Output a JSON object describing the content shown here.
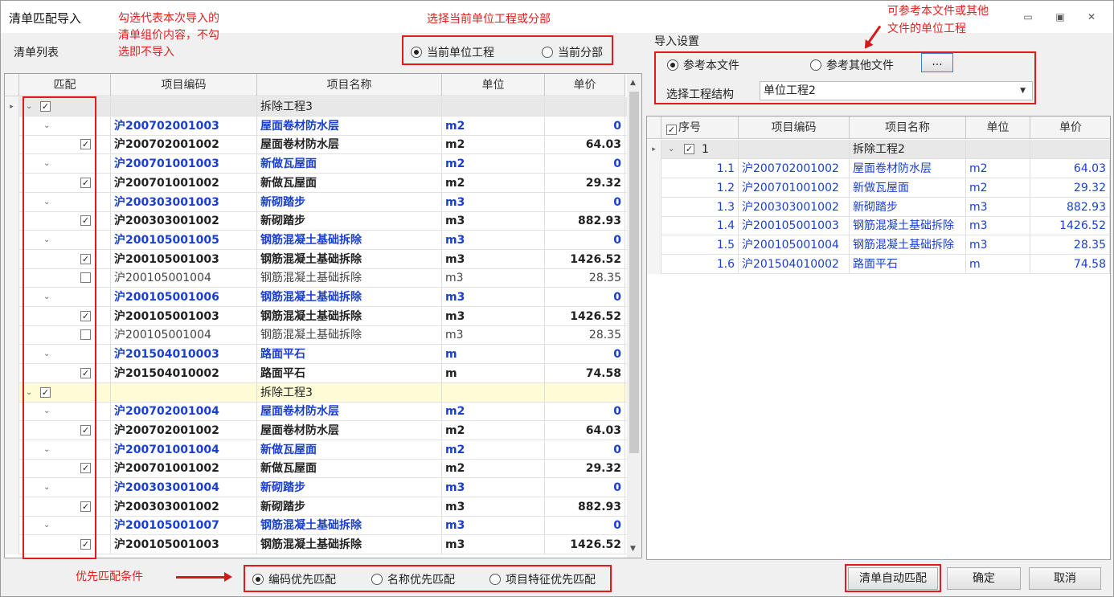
{
  "window": {
    "title": "清单匹配导入"
  },
  "notes": {
    "checkbox_hint": "勾选代表本次导入的\n清单组价内容，不勾\n选即不导入",
    "scope_hint": "选择当前单位工程或分部",
    "ref_hint": "可参考本文件或其他\n文件的单位工程",
    "priority_hint": "优先匹配条件"
  },
  "left": {
    "list_label": "清单列表",
    "scope_options": [
      {
        "label": "当前单位工程",
        "selected": true
      },
      {
        "label": "当前分部",
        "selected": false
      }
    ],
    "columns": [
      "匹配",
      "项目编码",
      "项目名称",
      "单位",
      "单价"
    ],
    "rows": [
      {
        "kind": "group",
        "checked": true,
        "code": "",
        "name": "拆除工程3",
        "unit": "",
        "price": ""
      },
      {
        "kind": "target",
        "code": "沪200702001003",
        "name": "屋面卷材防水层",
        "unit": "m2",
        "price": "0"
      },
      {
        "kind": "match",
        "checked": true,
        "code": "沪200702001002",
        "name": "屋面卷材防水层",
        "unit": "m2",
        "price": "64.03"
      },
      {
        "kind": "target",
        "code": "沪200701001003",
        "name": "新做瓦屋面",
        "unit": "m2",
        "price": "0"
      },
      {
        "kind": "match",
        "checked": true,
        "code": "沪200701001002",
        "name": "新做瓦屋面",
        "unit": "m2",
        "price": "29.32"
      },
      {
        "kind": "target",
        "code": "沪200303001003",
        "name": "新砌踏步",
        "unit": "m3",
        "price": "0"
      },
      {
        "kind": "match",
        "checked": true,
        "code": "沪200303001002",
        "name": "新砌踏步",
        "unit": "m3",
        "price": "882.93"
      },
      {
        "kind": "target",
        "code": "沪200105001005",
        "name": "钢筋混凝土基础拆除",
        "unit": "m3",
        "price": "0"
      },
      {
        "kind": "match",
        "checked": true,
        "code": "沪200105001003",
        "name": "钢筋混凝土基础拆除",
        "unit": "m3",
        "price": "1426.52"
      },
      {
        "kind": "alt",
        "checked": false,
        "code": "沪200105001004",
        "name": "钢筋混凝土基础拆除",
        "unit": "m3",
        "price": "28.35"
      },
      {
        "kind": "target",
        "code": "沪200105001006",
        "name": "钢筋混凝土基础拆除",
        "unit": "m3",
        "price": "0"
      },
      {
        "kind": "match",
        "checked": true,
        "code": "沪200105001003",
        "name": "钢筋混凝土基础拆除",
        "unit": "m3",
        "price": "1426.52"
      },
      {
        "kind": "alt",
        "checked": false,
        "code": "沪200105001004",
        "name": "钢筋混凝土基础拆除",
        "unit": "m3",
        "price": "28.35"
      },
      {
        "kind": "target",
        "code": "沪201504010003",
        "name": "路面平石",
        "unit": "m",
        "price": "0"
      },
      {
        "kind": "match",
        "checked": true,
        "code": "沪201504010002",
        "name": "路面平石",
        "unit": "m",
        "price": "74.58"
      },
      {
        "kind": "group2",
        "checked": true,
        "code": "",
        "name": "拆除工程3",
        "unit": "",
        "price": ""
      },
      {
        "kind": "target",
        "code": "沪200702001004",
        "name": "屋面卷材防水层",
        "unit": "m2",
        "price": "0"
      },
      {
        "kind": "match",
        "checked": true,
        "code": "沪200702001002",
        "name": "屋面卷材防水层",
        "unit": "m2",
        "price": "64.03"
      },
      {
        "kind": "target",
        "code": "沪200701001004",
        "name": "新做瓦屋面",
        "unit": "m2",
        "price": "0"
      },
      {
        "kind": "match",
        "checked": true,
        "code": "沪200701001002",
        "name": "新做瓦屋面",
        "unit": "m2",
        "price": "29.32"
      },
      {
        "kind": "target",
        "code": "沪200303001004",
        "name": "新砌踏步",
        "unit": "m3",
        "price": "0"
      },
      {
        "kind": "match",
        "checked": true,
        "code": "沪200303001002",
        "name": "新砌踏步",
        "unit": "m3",
        "price": "882.93"
      },
      {
        "kind": "target",
        "code": "沪200105001007",
        "name": "钢筋混凝土基础拆除",
        "unit": "m3",
        "price": "0"
      },
      {
        "kind": "match",
        "checked": true,
        "code": "沪200105001003",
        "name": "钢筋混凝土基础拆除",
        "unit": "m3",
        "price": "1426.52"
      }
    ]
  },
  "right": {
    "section_label": "导入设置",
    "ref_options": [
      {
        "label": "参考本文件",
        "selected": true
      },
      {
        "label": "参考其他文件",
        "selected": false
      }
    ],
    "browse_label": "...",
    "structure_label": "选择工程结构",
    "structure_value": "单位工程2",
    "columns": [
      "序号",
      "项目编码",
      "项目名称",
      "单位",
      "单价"
    ],
    "group": {
      "seq": "1",
      "name": "拆除工程2"
    },
    "rows": [
      {
        "seq": "1.1",
        "code": "沪200702001002",
        "name": "屋面卷材防水层",
        "unit": "m2",
        "price": "64.03"
      },
      {
        "seq": "1.2",
        "code": "沪200701001002",
        "name": "新做瓦屋面",
        "unit": "m2",
        "price": "29.32"
      },
      {
        "seq": "1.3",
        "code": "沪200303001002",
        "name": "新砌踏步",
        "unit": "m3",
        "price": "882.93"
      },
      {
        "seq": "1.4",
        "code": "沪200105001003",
        "name": "钢筋混凝土基础拆除",
        "unit": "m3",
        "price": "1426.52"
      },
      {
        "seq": "1.5",
        "code": "沪200105001004",
        "name": "钢筋混凝土基础拆除",
        "unit": "m3",
        "price": "28.35"
      },
      {
        "seq": "1.6",
        "code": "沪201504010002",
        "name": "路面平石",
        "unit": "m",
        "price": "74.58"
      }
    ]
  },
  "footer": {
    "priority_options": [
      {
        "label": "编码优先匹配",
        "selected": true
      },
      {
        "label": "名称优先匹配",
        "selected": false
      },
      {
        "label": "项目特征优先匹配",
        "selected": false
      }
    ],
    "auto_match_label": "清单自动匹配",
    "ok_label": "确定",
    "cancel_label": "取消"
  },
  "colors": {
    "blue": "#1a3fd0",
    "group_bg": "#e8e8e8",
    "group2_bg": "#fdfcd6",
    "red": "#e41a1a"
  }
}
